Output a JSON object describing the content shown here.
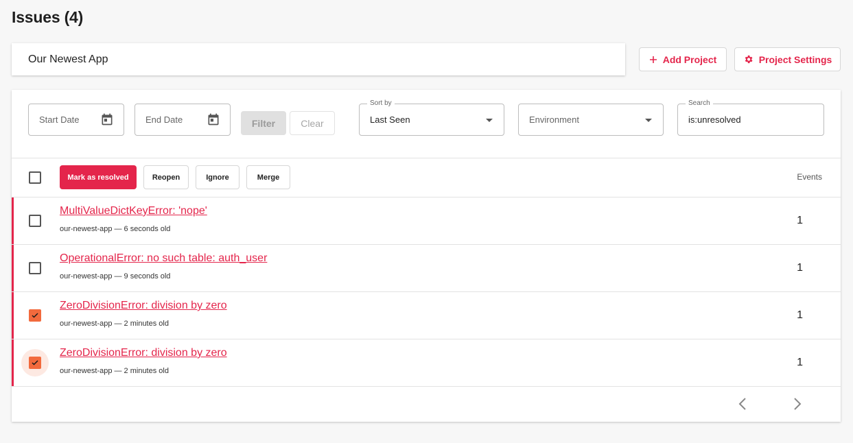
{
  "page": {
    "title": "Issues (4)"
  },
  "project": {
    "selected": "Our Newest App"
  },
  "toolbar": {
    "add_project": "Add Project",
    "project_settings": "Project Settings"
  },
  "filters": {
    "start_date_placeholder": "Start Date",
    "end_date_placeholder": "End Date",
    "filter_label": "Filter",
    "clear_label": "Clear",
    "sort_by_label": "Sort by",
    "sort_by_value": "Last Seen",
    "environment_placeholder": "Environment",
    "search_label": "Search",
    "search_value": "is:unresolved"
  },
  "actions": {
    "mark_resolved": "Mark as resolved",
    "reopen": "Reopen",
    "ignore": "Ignore",
    "merge": "Merge",
    "events_header": "Events"
  },
  "issues": [
    {
      "title": "MultiValueDictKeyError: 'nope'",
      "meta": "our-newest-app — 6 seconds old",
      "events": "1",
      "checked": false
    },
    {
      "title": "OperationalError: no such table: auth_user",
      "meta": "our-newest-app — 9 seconds old",
      "events": "1",
      "checked": false
    },
    {
      "title": "ZeroDivisionError: division by zero",
      "meta": "our-newest-app — 2 minutes old",
      "events": "1",
      "checked": true
    },
    {
      "title": "ZeroDivisionError: division by zero",
      "meta": "our-newest-app — 2 minutes old",
      "events": "1",
      "checked": true
    }
  ],
  "colors": {
    "accent": "#e4254b",
    "checkbox_checked": "#f26a3d"
  },
  "icons": {
    "add_project": "plus-icon",
    "project_settings": "gear-icon",
    "date": "calendar-icon",
    "dropdown": "caret-down-icon",
    "prev": "chevron-left-icon",
    "next": "chevron-right-icon"
  }
}
